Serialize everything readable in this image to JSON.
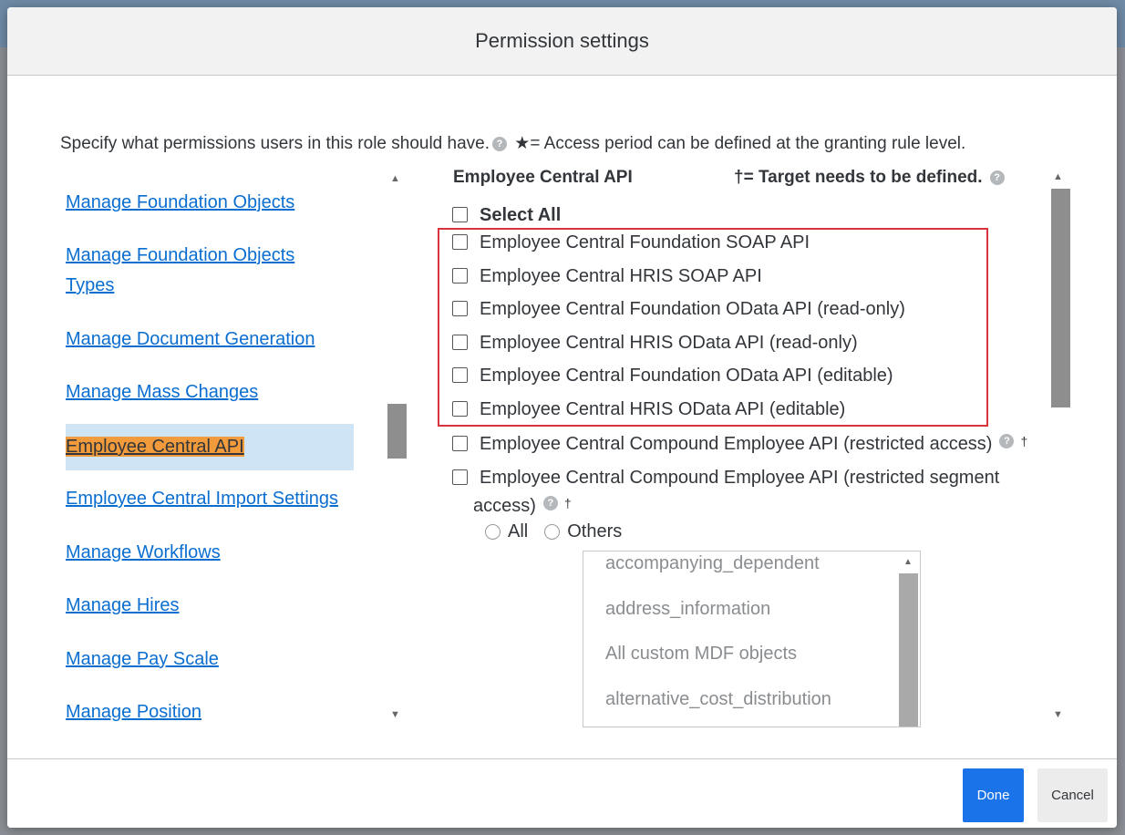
{
  "dialog": {
    "title": "Permission settings",
    "intro_text": "Specify what permissions users in this role should have.",
    "intro_star_note": "★= Access period can be defined at the granting rule level."
  },
  "nav": {
    "items": [
      {
        "label": "Manage Foundation Objects"
      },
      {
        "label": "Manage Foundation Objects"
      },
      {
        "label": "Types"
      },
      {
        "label": "Manage Document Generation"
      },
      {
        "label": "Manage Mass Changes"
      },
      {
        "label": "Employee Central API",
        "selected": true
      },
      {
        "label": "Employee Central Import Settings"
      },
      {
        "label": "Manage Workflows"
      },
      {
        "label": "Manage Hires"
      },
      {
        "label": "Manage Pay Scale"
      },
      {
        "label": "Manage Position"
      }
    ]
  },
  "pane": {
    "title": "Employee Central API",
    "target_note": "†= Target needs to be defined.",
    "select_all": "Select All",
    "permissions": [
      "Employee Central Foundation SOAP API",
      "Employee Central HRIS SOAP API",
      "Employee Central Foundation OData API (read-only)",
      "Employee Central HRIS OData API (read-only)",
      "Employee Central Foundation OData API (editable)",
      "Employee Central HRIS OData API (editable)",
      "Employee Central Compound Employee API (restricted access)",
      "Employee Central Compound Employee API (restricted segment",
      "access)"
    ],
    "dagger": "†",
    "radio_all": "All",
    "radio_others": "Others",
    "segments": [
      "accompanying_dependent",
      "address_information",
      "All custom MDF objects",
      "alternative_cost_distribution"
    ]
  },
  "footer": {
    "done_label": "Done",
    "cancel_label": "Cancel"
  },
  "colors": {
    "link": "#0a6ed1",
    "selected_bg": "#cfe4f4",
    "selected_highlight": "#f19b3c",
    "done_button": "#1a73e8",
    "annotation_box": "#d9333f"
  }
}
